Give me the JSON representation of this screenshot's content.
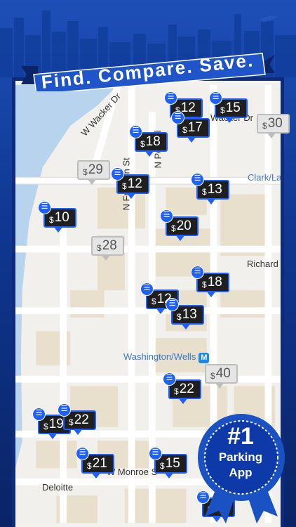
{
  "banner": {
    "tagline": "Find. Compare. Save."
  },
  "streets": {
    "wacker_dr": "W Wacker Dr",
    "wacker_dr2": "Wacker Dr",
    "franklin": "N Franklin St",
    "n_post": "N Post Pl",
    "clark": "Clark/La",
    "richard": "Richard",
    "washington": "Washington/Wells",
    "metro_letter": "M",
    "monroe": "W Monroe S",
    "deloitte": "Deloitte"
  },
  "prices": [
    {
      "cur": "$",
      "amt": "12",
      "style": "blue"
    },
    {
      "cur": "$",
      "amt": "15",
      "style": "blue"
    },
    {
      "cur": "$",
      "amt": "30",
      "style": "gray"
    },
    {
      "cur": "$",
      "amt": "17",
      "style": "blue"
    },
    {
      "cur": "$",
      "amt": "18",
      "style": "blue"
    },
    {
      "cur": "$",
      "amt": "29",
      "style": "gray"
    },
    {
      "cur": "$",
      "amt": "12",
      "style": "blue"
    },
    {
      "cur": "$",
      "amt": "13",
      "style": "blue"
    },
    {
      "cur": "$",
      "amt": "10",
      "style": "blue"
    },
    {
      "cur": "$",
      "amt": "20",
      "style": "blue"
    },
    {
      "cur": "$",
      "amt": "28",
      "style": "gray"
    },
    {
      "cur": "$",
      "amt": "18",
      "style": "blue"
    },
    {
      "cur": "$",
      "amt": "12",
      "style": "blue"
    },
    {
      "cur": "$",
      "amt": "13",
      "style": "blue"
    },
    {
      "cur": "$",
      "amt": "40",
      "style": "gray"
    },
    {
      "cur": "$",
      "amt": "22",
      "style": "blue"
    },
    {
      "cur": "$",
      "amt": "19",
      "style": "blue"
    },
    {
      "cur": "$",
      "amt": "22",
      "style": "blue"
    },
    {
      "cur": "$",
      "amt": "21",
      "style": "blue"
    },
    {
      "cur": "$",
      "amt": "15",
      "style": "blue"
    },
    {
      "cur": "$",
      "amt": "12",
      "style": "blue"
    }
  ],
  "badge": {
    "rank": "#1",
    "line1": "Parking",
    "line2": "App"
  },
  "colors": {
    "accent": "#1e5fff",
    "frame": "#0d2b7a",
    "river": "#b7d3ee",
    "pin_dark": "#1f1f1f"
  }
}
